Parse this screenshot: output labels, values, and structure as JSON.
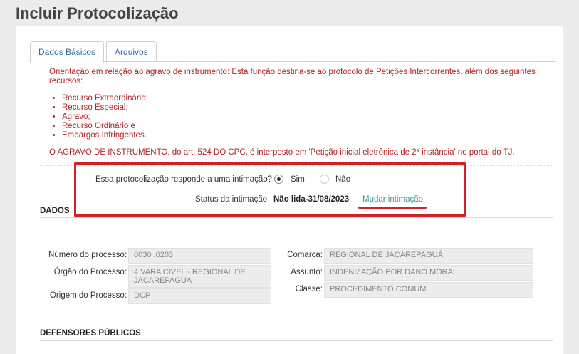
{
  "page_title": "Incluir Protocolização",
  "tabs": [
    {
      "label": "Dados Básicos",
      "active": true
    },
    {
      "label": "Arquivos",
      "active": false
    }
  ],
  "notice": {
    "intro": "Orientação em relação ao agravo de instrumento: Esta função destina-se ao protocolo de Petições Intercorrentes, além dos seguintes recursos:",
    "items": [
      "Recurso Extraordinário;",
      "Recurso Especial;",
      "Agravo;",
      "Recurso Ordinário e",
      "Embargos Infringentes."
    ],
    "footer": "O AGRAVO DE INSTRUMENTO, do art. 524 DO CPC, é interposto em 'Petição inicial eletrônica de 2ª instância' no portal do TJ."
  },
  "intimacao": {
    "question": "Essa protocolização responde a uma intimação?",
    "options": [
      {
        "label": "Sim",
        "selected": true
      },
      {
        "label": "Não",
        "selected": false
      }
    ],
    "status_label": "Status da intimação:",
    "status_value": "Não lida-31/08/2023",
    "separator": "|",
    "change_link": "Mudar intimação"
  },
  "dados": {
    "title": "DADOS",
    "left": [
      {
        "label": "Número do processo:",
        "value": "0030                        .0203"
      },
      {
        "label": "Órgão do Processo:",
        "value": "4 VARA CIVEL - REGIONAL DE JACAREPAGUA"
      },
      {
        "label": "Origem do Processo:",
        "value": "DCP"
      }
    ],
    "right": [
      {
        "label": "Comarca:",
        "value": "REGIONAL DE JACAREPAGUÁ"
      },
      {
        "label": "Assunto:",
        "value": "INDENIZAÇÃO POR DANO MORAL"
      },
      {
        "label": "Classe:",
        "value": "PROCEDIMENTO COMUM"
      }
    ]
  },
  "defensores": {
    "title": "DEFENSORES PÚBLICOS"
  },
  "colors": {
    "highlight": "#d2202a",
    "notice_text": "#b22222",
    "link": "#3a9a9a",
    "tab_text": "#2e6da4"
  }
}
